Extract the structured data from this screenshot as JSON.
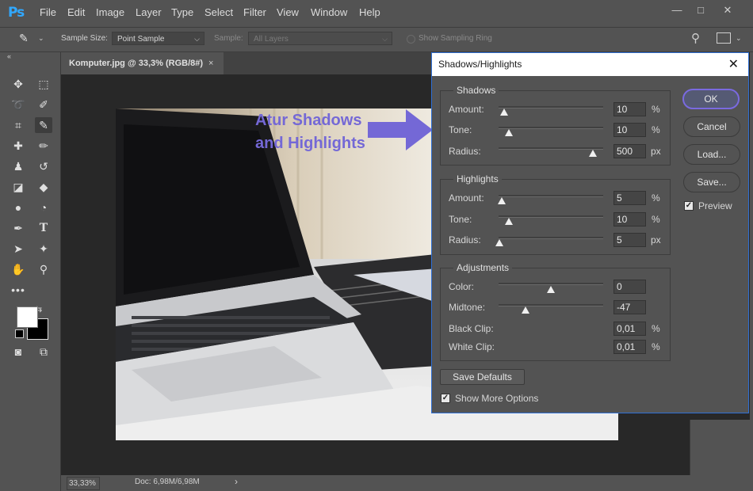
{
  "app": {
    "logo": "Ps",
    "menu": [
      "File",
      "Edit",
      "Image",
      "Layer",
      "Type",
      "Select",
      "Filter",
      "View",
      "Window",
      "Help"
    ]
  },
  "options_bar": {
    "sample_size_label": "Sample Size:",
    "sample_size_value": "Point Sample",
    "sample_label": "Sample:",
    "sample_value": "All Layers",
    "sampling_ring_label": "Show Sampling Ring"
  },
  "document": {
    "tab_title": "Komputer.jpg @ 33,3% (RGB/8#)",
    "tab_close": "×",
    "zoom": "33,33%",
    "doc_size": "Doc: 6,98M/6,98M",
    "status_arrow": "›"
  },
  "annotation": {
    "line1": "Atur Shadows",
    "line2": "and Highlights",
    "color": "#7468d6"
  },
  "dialog": {
    "title": "Shadows/Highlights",
    "close": "✕",
    "shadows": {
      "title": "Shadows",
      "amount_label": "Amount:",
      "amount_value": "10",
      "amount_unit": "%",
      "amount_pos": 0.05,
      "tone_label": "Tone:",
      "tone_value": "10",
      "tone_unit": "%",
      "tone_pos": 0.1,
      "radius_label": "Radius:",
      "radius_value": "500",
      "radius_unit": "px",
      "radius_pos": 0.9
    },
    "highlights": {
      "title": "Highlights",
      "amount_label": "Amount:",
      "amount_value": "5",
      "amount_unit": "%",
      "amount_pos": 0.03,
      "tone_label": "Tone:",
      "tone_value": "10",
      "tone_unit": "%",
      "tone_pos": 0.1,
      "radius_label": "Radius:",
      "radius_value": "5",
      "radius_unit": "px",
      "radius_pos": 0.01
    },
    "adjustments": {
      "title": "Adjustments",
      "color_label": "Color:",
      "color_value": "0",
      "color_pos": 0.5,
      "midtone_label": "Midtone:",
      "midtone_value": "-47",
      "midtone_pos": 0.26,
      "black_clip_label": "Black Clip:",
      "black_clip_value": "0,01",
      "black_clip_unit": "%",
      "white_clip_label": "White Clip:",
      "white_clip_value": "0,01",
      "white_clip_unit": "%"
    },
    "buttons": {
      "ok": "OK",
      "cancel": "Cancel",
      "load": "Load...",
      "save": "Save...",
      "save_defaults": "Save Defaults"
    },
    "preview_label": "Preview",
    "preview_checked": true,
    "more_options_label": "Show More Options",
    "more_options_checked": true
  }
}
